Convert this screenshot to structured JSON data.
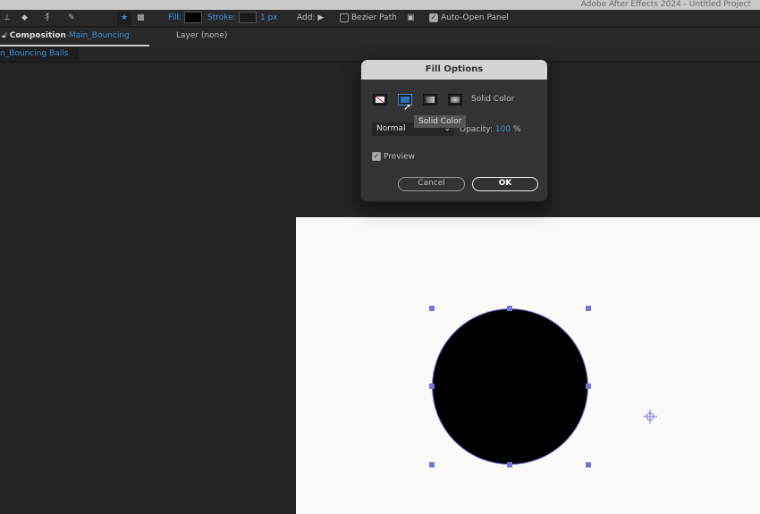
{
  "app_title": "Adobe After Effects 2024 - Untitled Project",
  "toolbar": {
    "fill_label": "Fill:",
    "stroke_label": "Stroke:",
    "stroke_width": "1 px",
    "add_label": "Add:",
    "bezier_label": "Bezier Path",
    "bezier_checked": false,
    "auto_open_label": "Auto-Open Panel",
    "auto_open_checked": true,
    "fill_color": "#000000",
    "stroke_color": "#1a1a1a"
  },
  "panels": {
    "composition_label": "Composition",
    "composition_name": "Main_Bouncing Balls",
    "layer_label": "Layer (none)",
    "subtab": "n_Bouncing Balls"
  },
  "dialog": {
    "title": "Fill Options",
    "fill_types": [
      "None",
      "Solid Color",
      "Linear Gradient",
      "Radial Gradient"
    ],
    "fill_type_label": "Solid Color",
    "tooltip": "Solid Color",
    "blend_mode": "Normal",
    "opacity_label": "Opacity:",
    "opacity_value": "100",
    "opacity_unit": "%",
    "preview_label": "Preview",
    "preview_checked": true,
    "cancel": "Cancel",
    "ok": "OK"
  },
  "colors": {
    "accent": "#3d8fd8",
    "handle": "#6f78d8",
    "comp_bg": "#fbfaf8"
  }
}
